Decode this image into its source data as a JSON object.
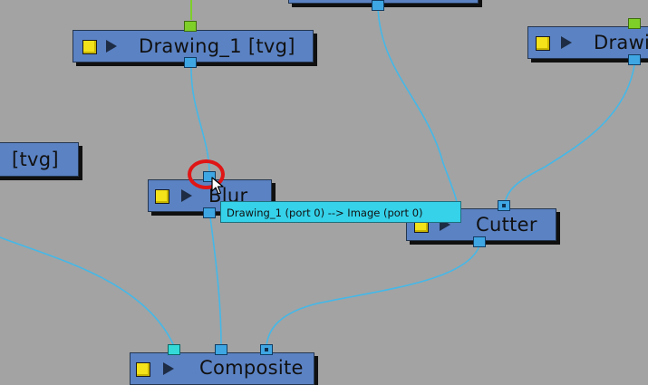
{
  "colors": {
    "background": "#a3a3a3",
    "node_fill": "#5b82c3",
    "cable": "#44b8e8",
    "cable_green": "#7fcf29",
    "tooltip": "#35d2ea",
    "highlight": "#e01515"
  },
  "nodes": {
    "drawing_1": {
      "title": "Drawing_1 [tvg]"
    },
    "drawing_right": {
      "title": "Drawi"
    },
    "left_partial": {
      "title": "[tvg]"
    },
    "blur": {
      "title": "Blur"
    },
    "cutter": {
      "title": "Cutter"
    },
    "composite": {
      "title": "Composite"
    }
  },
  "tooltip": {
    "text": "Drawing_1 (port 0) --> Image (port 0)"
  },
  "icons": {
    "enable_toggle": "yellow-square-icon",
    "expand": "play-arrow-icon",
    "cursor": "mouse-pointer-icon"
  }
}
